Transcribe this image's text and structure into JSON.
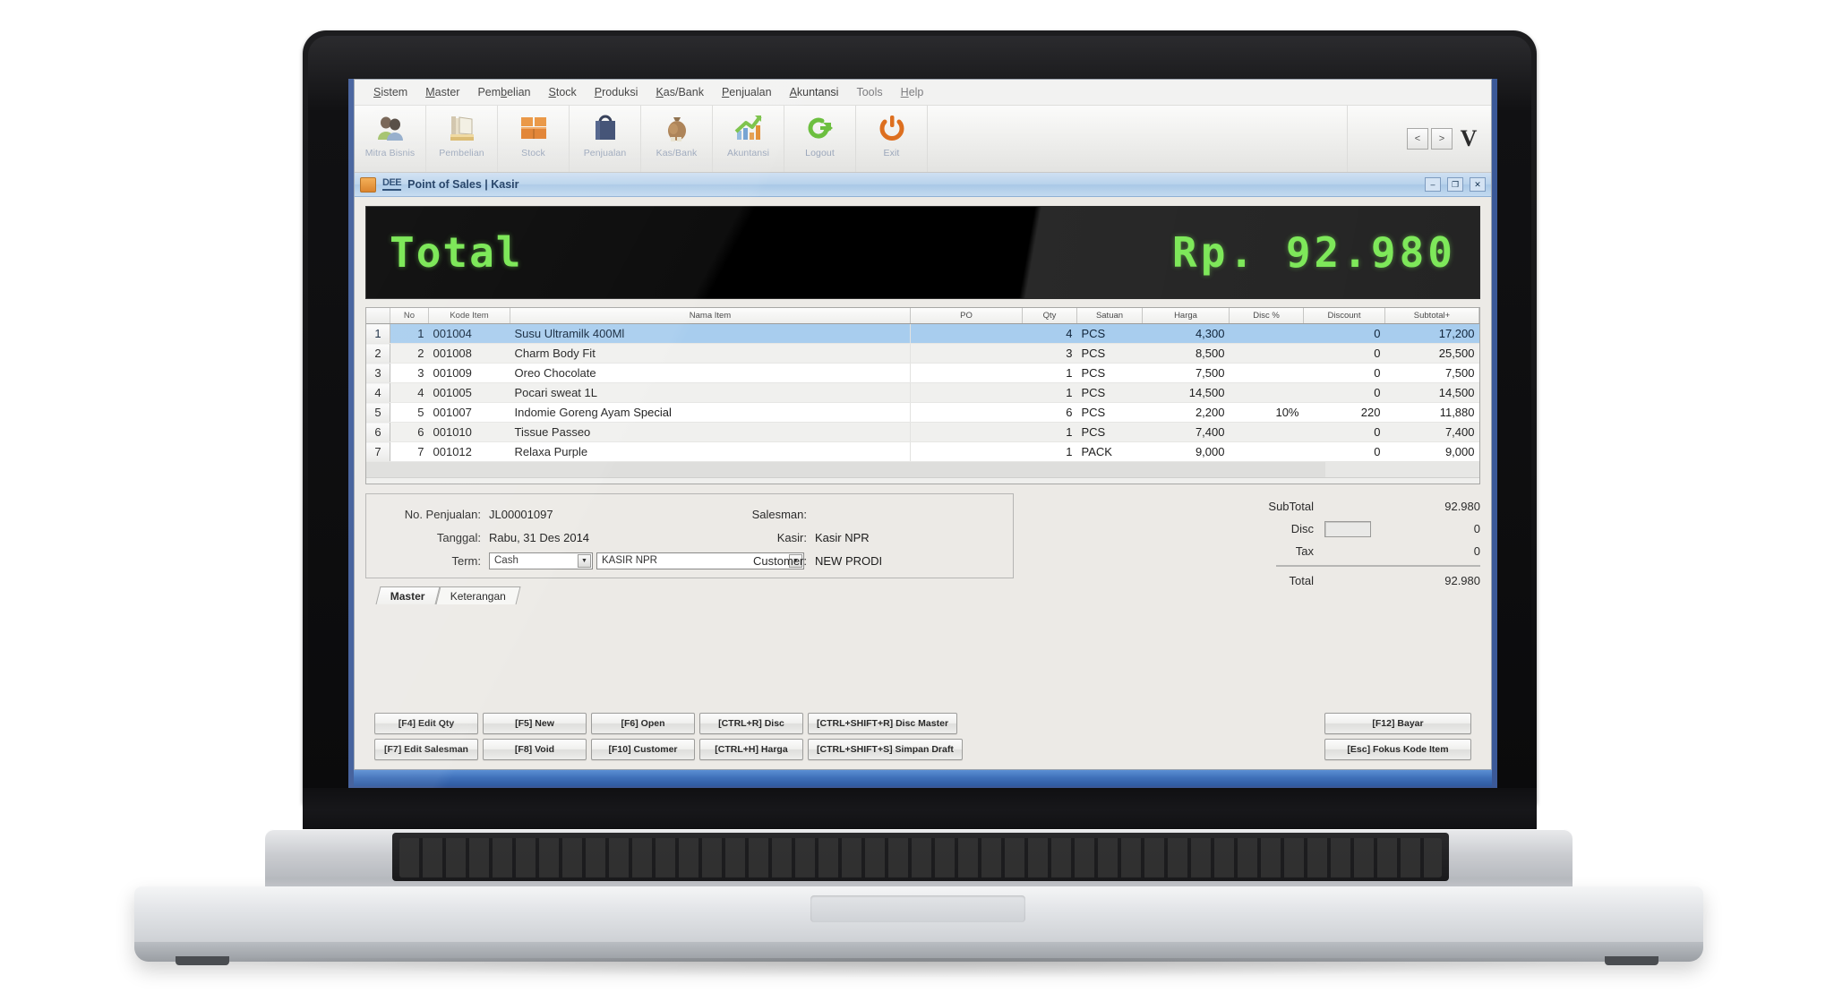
{
  "menubar": {
    "items": [
      {
        "label": "Sistem",
        "mnemonic": "S",
        "dim": false
      },
      {
        "label": "Master",
        "mnemonic": "M",
        "dim": false
      },
      {
        "label": "Pembelian",
        "mnemonic": "b",
        "dim": false
      },
      {
        "label": "Stock",
        "mnemonic": "S",
        "dim": false
      },
      {
        "label": "Produksi",
        "mnemonic": "P",
        "dim": false
      },
      {
        "label": "Kas/Bank",
        "mnemonic": "K",
        "dim": false
      },
      {
        "label": "Penjualan",
        "mnemonic": "P",
        "dim": false
      },
      {
        "label": "Akuntansi",
        "mnemonic": "A",
        "dim": false
      },
      {
        "label": "Tools",
        "mnemonic": "",
        "dim": true
      },
      {
        "label": "Help",
        "mnemonic": "H",
        "dim": true
      }
    ]
  },
  "toolbar": {
    "buttons": [
      {
        "label": "Mitra Bisnis",
        "icon": "people-icon"
      },
      {
        "label": "Pembelian",
        "icon": "book-shelf-icon"
      },
      {
        "label": "Stock",
        "icon": "boxes-icon"
      },
      {
        "label": "Penjualan",
        "icon": "shopping-bag-icon"
      },
      {
        "label": "Kas/Bank",
        "icon": "money-bag-icon"
      },
      {
        "label": "Akuntansi",
        "icon": "growth-chart-icon"
      },
      {
        "label": "Logout",
        "icon": "logout-arrow-icon"
      },
      {
        "label": "Exit",
        "icon": "power-icon"
      }
    ],
    "nav_prev": "<",
    "nav_next": ">",
    "corner_letter": "V"
  },
  "mdi_window": {
    "brand": "DEE",
    "title": "Point of Sales | Kasir",
    "buttons": [
      {
        "glyph": "–",
        "name": "minimize"
      },
      {
        "glyph": "❐",
        "name": "restore"
      },
      {
        "glyph": "✕",
        "name": "close"
      }
    ]
  },
  "total_display": {
    "label": "Total",
    "value": "Rp. 92.980",
    "color": "#7ee85a",
    "background": "#000000"
  },
  "grid": {
    "columns": [
      "No",
      "Kode Item",
      "Nama Item",
      "PO",
      "Qty",
      "Satuan",
      "Harga",
      "Disc %",
      "Discount",
      "Subtotal+"
    ],
    "rows": [
      {
        "rh": "1",
        "no": "1",
        "kode": "001004",
        "nama": "Susu Ultramilk 400Ml",
        "po": "",
        "qty": "4",
        "satuan": "PCS",
        "harga": "4,300",
        "disc": "",
        "discount": "0",
        "subtotal": "17,200",
        "selected": true
      },
      {
        "rh": "2",
        "no": "2",
        "kode": "001008",
        "nama": "Charm Body Fit",
        "po": "",
        "qty": "3",
        "satuan": "PCS",
        "harga": "8,500",
        "disc": "",
        "discount": "0",
        "subtotal": "25,500",
        "selected": false
      },
      {
        "rh": "3",
        "no": "3",
        "kode": "001009",
        "nama": "Oreo Chocolate",
        "po": "",
        "qty": "1",
        "satuan": "PCS",
        "harga": "7,500",
        "disc": "",
        "discount": "0",
        "subtotal": "7,500",
        "selected": false
      },
      {
        "rh": "4",
        "no": "4",
        "kode": "001005",
        "nama": "Pocari sweat 1L",
        "po": "",
        "qty": "1",
        "satuan": "PCS",
        "harga": "14,500",
        "disc": "",
        "discount": "0",
        "subtotal": "14,500",
        "selected": false
      },
      {
        "rh": "5",
        "no": "5",
        "kode": "001007",
        "nama": "Indomie Goreng Ayam Special",
        "po": "",
        "qty": "6",
        "satuan": "PCS",
        "harga": "2,200",
        "disc": "10%",
        "discount": "220",
        "subtotal": "11,880",
        "selected": false
      },
      {
        "rh": "6",
        "no": "6",
        "kode": "001010",
        "nama": "Tissue Passeo",
        "po": "",
        "qty": "1",
        "satuan": "PCS",
        "harga": "7,400",
        "disc": "",
        "discount": "0",
        "subtotal": "7,400",
        "selected": false
      },
      {
        "rh": "7",
        "no": "7",
        "kode": "001012",
        "nama": "Relaxa Purple",
        "po": "",
        "qty": "1",
        "satuan": "PACK",
        "harga": "9,000",
        "disc": "",
        "discount": "0",
        "subtotal": "9,000",
        "selected": false
      }
    ]
  },
  "form": {
    "no_penjualan_label": "No. Penjualan:",
    "no_penjualan_value": "JL00001097",
    "tanggal_label": "Tanggal:",
    "tanggal_value": "Rabu, 31 Des 2014",
    "term_label": "Term:",
    "term_value": "Cash",
    "term_account_value": "KASIR NPR",
    "salesman_label": "Salesman:",
    "salesman_value": "",
    "kasir_label": "Kasir:",
    "kasir_value": "Kasir NPR",
    "customer_label": "Customer:",
    "customer_value": "NEW PRODI"
  },
  "tabs": [
    {
      "label": "Master",
      "active": true
    },
    {
      "label": "Keterangan",
      "active": false
    }
  ],
  "totals": {
    "subtotal_label": "SubTotal",
    "subtotal_value": "92.980",
    "disc_label": "Disc",
    "disc_input_value": "",
    "disc_value": "0",
    "tax_label": "Tax",
    "tax_value": "0",
    "total_label": "Total",
    "total_value": "92.980"
  },
  "function_buttons": {
    "left_row1": [
      {
        "label": "[F4] Edit Qty"
      },
      {
        "label": "[F5] New"
      },
      {
        "label": "[F6] Open"
      },
      {
        "label": "[CTRL+R] Disc"
      },
      {
        "label": "[CTRL+SHIFT+R] Disc Master"
      }
    ],
    "left_row2": [
      {
        "label": "[F7] Edit Salesman"
      },
      {
        "label": "[F8] Void"
      },
      {
        "label": "[F10] Customer"
      },
      {
        "label": "[CTRL+H] Harga"
      },
      {
        "label": "[CTRL+SHIFT+S] Simpan Draft"
      }
    ],
    "right": [
      {
        "label": "[F12] Bayar"
      },
      {
        "label": "[Esc] Fokus Kode Item"
      }
    ]
  }
}
